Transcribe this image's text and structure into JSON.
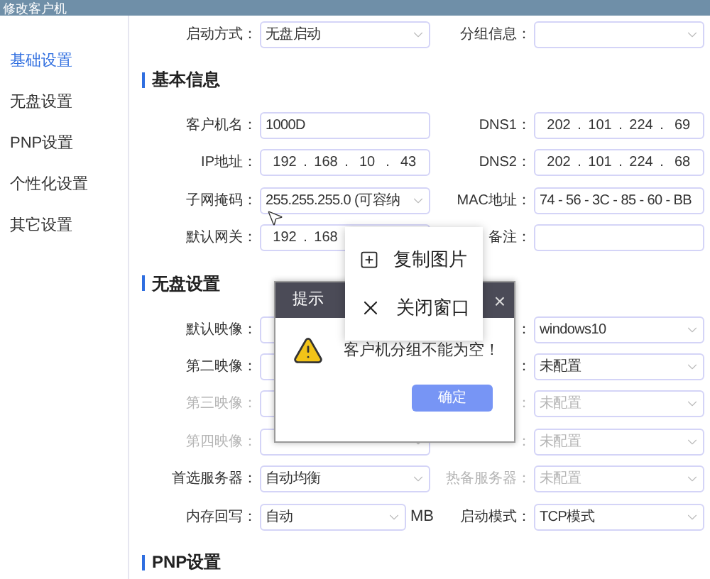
{
  "window": {
    "title": "修改客户机"
  },
  "sidebar": {
    "items": [
      {
        "label": "基础设置",
        "selected": true
      },
      {
        "label": "无盘设置",
        "selected": false
      },
      {
        "label": "PNP设置",
        "selected": false
      },
      {
        "label": "个性化设置",
        "selected": false
      },
      {
        "label": "其它设置",
        "selected": false
      }
    ]
  },
  "rows": [
    {
      "kind": "row",
      "left": {
        "label": "启动方式：",
        "kind": "select",
        "value": "无盘启动",
        "disabled": false
      },
      "right": {
        "label": "分组信息：",
        "kind": "select",
        "disabled": false
      }
    },
    {
      "kind": "heading",
      "text": "基本信息"
    },
    {
      "kind": "row",
      "left": {
        "label": "客户机名：",
        "kind": "text",
        "value": "1000D",
        "disabled": false
      },
      "right": {
        "label": "DNS1：",
        "kind": "ip",
        "segments": [
          "202",
          "101",
          "224",
          "69"
        ],
        "separator": ".",
        "disabled": false
      }
    },
    {
      "kind": "row",
      "left": {
        "label": "IP地址：",
        "kind": "ip",
        "segments": [
          "192",
          "168",
          "10",
          "43"
        ],
        "separator": ".",
        "disabled": false
      },
      "right": {
        "label": "DNS2：",
        "kind": "ip",
        "segments": [
          "202",
          "101",
          "224",
          "68"
        ],
        "separator": ".",
        "disabled": false
      }
    },
    {
      "kind": "row",
      "left": {
        "label": "子网掩码：",
        "kind": "select",
        "value": "255.255.255.0 (可容纳",
        "disabled": false
      },
      "right": {
        "label": "MAC地址：",
        "kind": "text",
        "value": "74 - 56 - 3C - 85 - 60 - BB",
        "disabled": false
      }
    },
    {
      "kind": "row",
      "left": {
        "label": "默认网关：",
        "kind": "ip",
        "segments": [
          "192",
          "168"
        ],
        "separator": ".",
        "disabled": false
      },
      "right": {
        "label": "备注：",
        "kind": "text",
        "disabled": false
      }
    },
    {
      "kind": "heading",
      "text": "无盘设置"
    },
    {
      "kind": "row",
      "left": {
        "label": "默认映像：",
        "kind": "select",
        "disabled": false
      },
      "right": {
        "label": "：",
        "kind": "select",
        "value": "windows10",
        "disabled": false
      }
    },
    {
      "kind": "row",
      "left": {
        "label": "第二映像：",
        "kind": "select",
        "disabled": false
      },
      "right": {
        "label": "：",
        "kind": "select",
        "value": "未配置",
        "disabled": false
      }
    },
    {
      "kind": "row",
      "left": {
        "label": "第三映像：",
        "kind": "select",
        "disabled": true
      },
      "right": {
        "label": "：",
        "kind": "select",
        "value": "未配置",
        "disabled": true
      }
    },
    {
      "kind": "row",
      "left": {
        "label": "第四映像：",
        "kind": "select",
        "disabled": true
      },
      "right": {
        "label": "：",
        "kind": "select",
        "value": "未配置",
        "disabled": true
      }
    },
    {
      "kind": "row",
      "left": {
        "label": "首选服务器：",
        "kind": "select",
        "value": "自动均衡",
        "disabled": false
      },
      "right": {
        "label": "热备服务器：",
        "kind": "select",
        "value": "未配置",
        "disabled": true
      }
    },
    {
      "kind": "row",
      "left": {
        "label": "内存回写：",
        "kind": "select",
        "value": "自动",
        "suffix": "MB",
        "disabled": false
      },
      "right": {
        "label": "启动模式：",
        "kind": "select",
        "value": "TCP模式",
        "disabled": false
      }
    },
    {
      "kind": "heading",
      "text": "PNP设置"
    }
  ],
  "dialog": {
    "title": "提示",
    "close": "×",
    "message": "客户机分组不能为空！",
    "button": "确定"
  },
  "context_menu": {
    "items": [
      {
        "kind": "copy",
        "label": "复制图片"
      },
      {
        "kind": "close",
        "label": "关闭窗口"
      }
    ]
  }
}
